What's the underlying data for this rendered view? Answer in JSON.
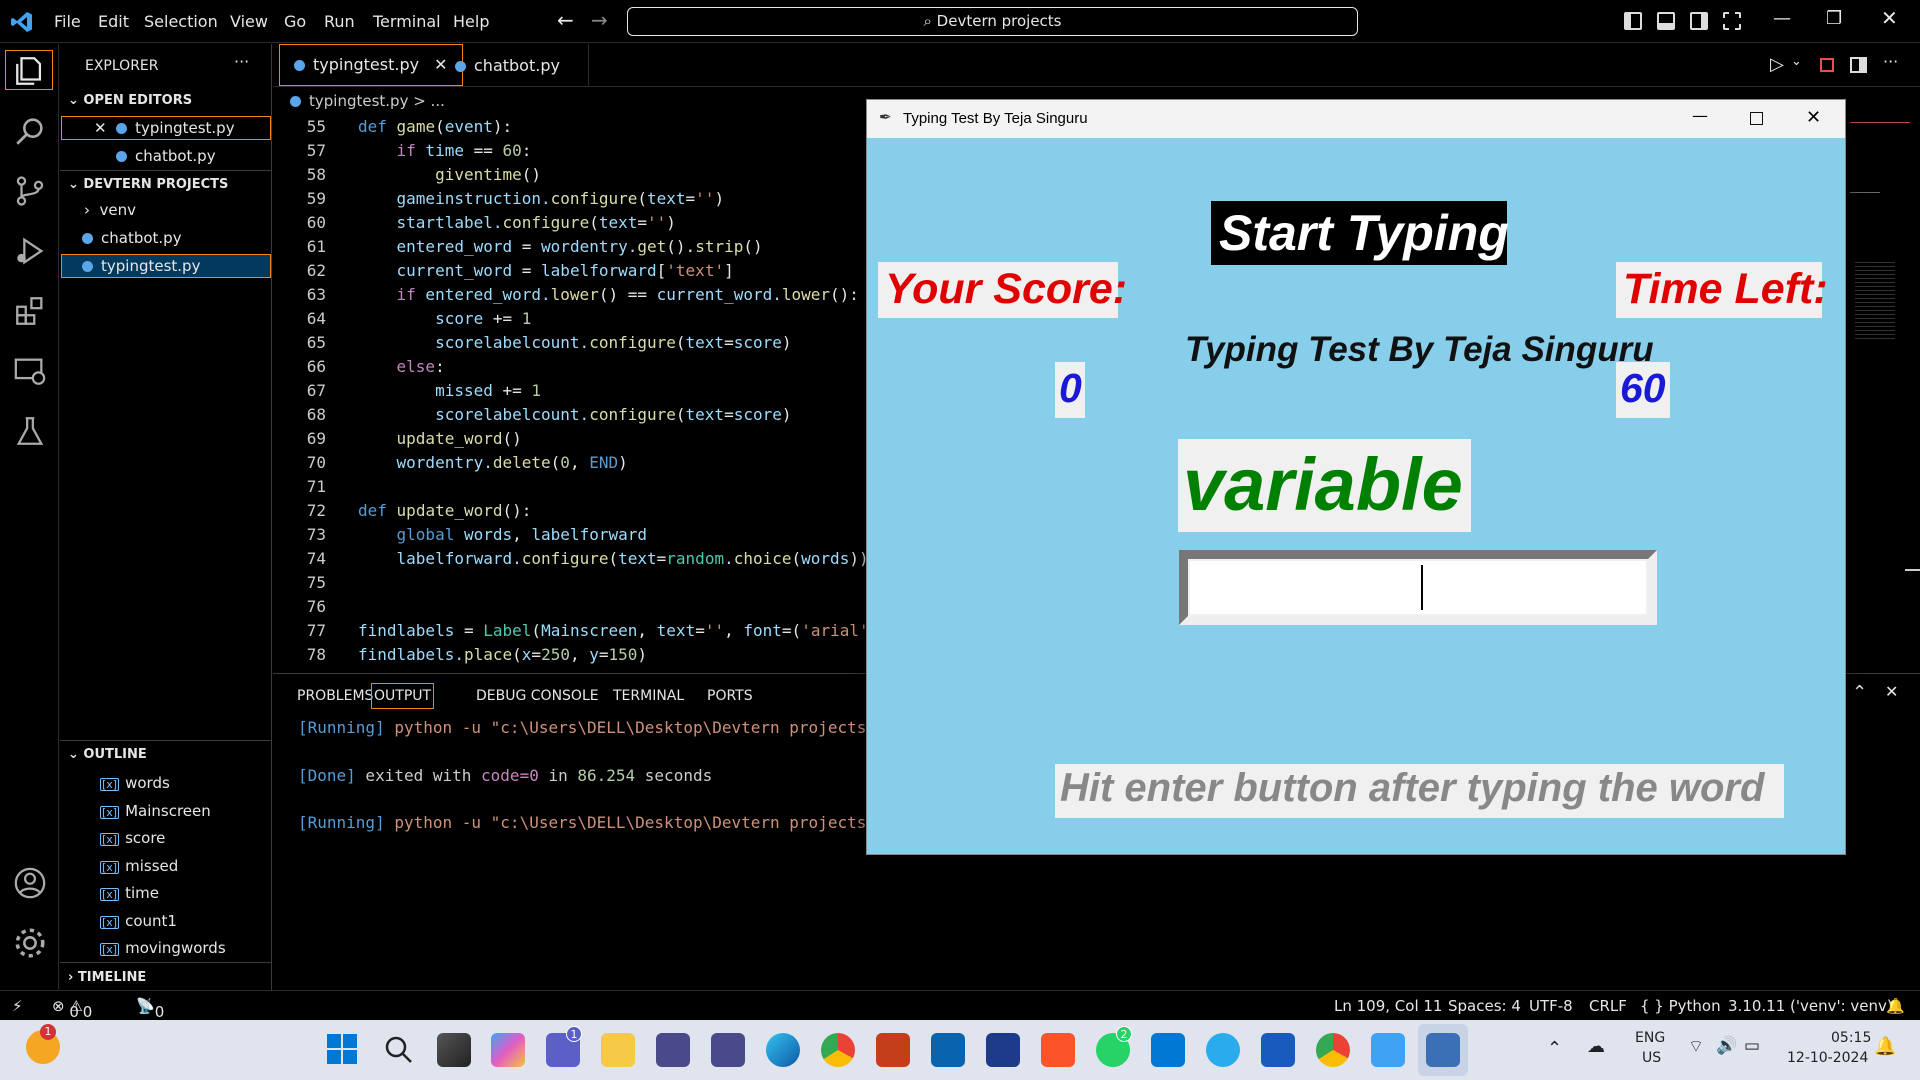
{
  "titlebar": {
    "menu": [
      "File",
      "Edit",
      "Selection",
      "View",
      "Go",
      "Run",
      "Terminal",
      "Help"
    ],
    "search": "Devtern projects"
  },
  "sidebar": {
    "explorer_label": "EXPLORER",
    "more": "···",
    "open_editors_label": "OPEN EDITORS",
    "open_editors": [
      "typingtest.py",
      "chatbot.py"
    ],
    "project_label": "DEVTERN PROJECTS",
    "project_items": [
      "venv",
      "chatbot.py",
      "typingtest.py"
    ],
    "outline_label": "OUTLINE",
    "outline_items": [
      "words",
      "Mainscreen",
      "score",
      "missed",
      "time",
      "count1",
      "movingwords"
    ],
    "timeline_label": "TIMELINE"
  },
  "tabs": [
    "typingtest.py",
    "chatbot.py"
  ],
  "breadcrumb": "typingtest.py > ...",
  "code": {
    "line_numbers": [
      "55",
      "57",
      "58",
      "59",
      "60",
      "61",
      "62",
      "63",
      "64",
      "65",
      "66",
      "67",
      "68",
      "69",
      "70",
      "71",
      "72",
      "73",
      "74",
      "75",
      "76",
      "77",
      "78"
    ]
  },
  "panel": {
    "tabs": [
      "PROBLEMS",
      "OUTPUT",
      "DEBUG CONSOLE",
      "TERMINAL",
      "PORTS"
    ],
    "out1_tag": "[Running]",
    "out1_cmd": " python -u \"c:\\Users\\DELL\\Desktop\\Devtern projects",
    "out2_tag": "[Done]",
    "out2_text": " exited with ",
    "out2_code": "code=0",
    "out2_in": " in ",
    "out2_num": "86.254",
    "out2_sec": " seconds",
    "out3_tag": "[Running]",
    "out3_cmd": " python -u \"c:\\Users\\DELL\\Desktop\\Devtern projects"
  },
  "statusbar": {
    "errors": "0",
    "warnings": "0",
    "ports": "0",
    "position": "Ln 109, Col 11",
    "spaces": "Spaces: 4",
    "encoding": "UTF-8",
    "eol": "CRLF",
    "language": "{ } Python",
    "interpreter": "3.10.11 ('venv': venv)"
  },
  "taskbar": {
    "lang1": "ENG",
    "lang2": "US",
    "time": "05:15",
    "date": "12-10-2024",
    "badge_teams": "1",
    "badge_whatsapp": "2",
    "badge_weather": "1"
  },
  "tkwindow": {
    "title": "Typing Test By Teja Singuru",
    "start_label": "Start Typing",
    "score_label": "Your Score:",
    "time_label": "Time Left:",
    "heading": "Typing Test By Teja Singuru",
    "score_value": "0",
    "time_value": "60",
    "word": "variable",
    "entry_value": "",
    "hint": "Hit enter button after typing the word"
  }
}
